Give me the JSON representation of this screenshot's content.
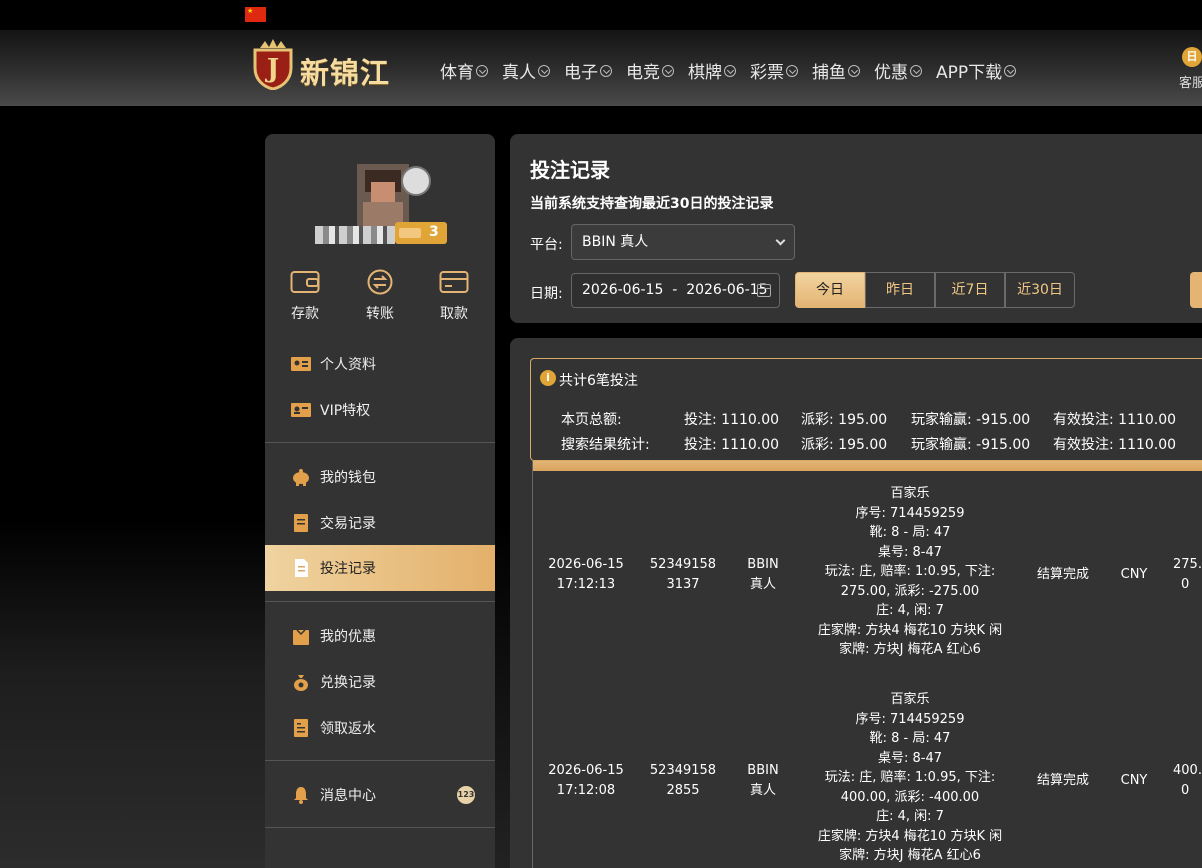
{
  "header": {
    "flag_icon": "china-flag-icon",
    "logo_text": "新锦江",
    "nav": [
      {
        "label": "体育"
      },
      {
        "label": "真人"
      },
      {
        "label": "电子"
      },
      {
        "label": "电竞"
      },
      {
        "label": "棋牌"
      },
      {
        "label": "彩票"
      },
      {
        "label": "捕鱼"
      },
      {
        "label": "优惠"
      },
      {
        "label": "APP下载"
      }
    ],
    "service_label": "客服"
  },
  "sidebar": {
    "vip_level": "3",
    "quick_actions": [
      {
        "label": "存款",
        "icon": "wallet-icon"
      },
      {
        "label": "转账",
        "icon": "transfer-icon"
      },
      {
        "label": "取款",
        "icon": "card-icon"
      }
    ],
    "menu": [
      {
        "label": "个人资料",
        "icon": "id-card-icon"
      },
      {
        "label": "VIP特权",
        "icon": "vip-card-icon"
      },
      {
        "label": "我的钱包",
        "icon": "piggy-bank-icon"
      },
      {
        "label": "交易记录",
        "icon": "ledger-icon"
      },
      {
        "label": "投注记录",
        "icon": "document-icon",
        "active": true
      },
      {
        "label": "我的优惠",
        "icon": "gift-box-icon"
      },
      {
        "label": "兑换记录",
        "icon": "money-bag-icon"
      },
      {
        "label": "领取返水",
        "icon": "receipt-icon"
      },
      {
        "label": "消息中心",
        "icon": "bell-icon",
        "badge": "123"
      }
    ]
  },
  "filter": {
    "title": "投注记录",
    "subtitle": "当前系统支持查询最近30日的投注记录",
    "platform_label": "平台:",
    "platform_value": "BBIN 真人",
    "date_label": "日期:",
    "date_range": "2026-06-15  -  2026-06-15",
    "quick_ranges": [
      "今日",
      "昨日",
      "近7日",
      "近30日"
    ]
  },
  "summary": {
    "title": "共计6笔投注",
    "rows": [
      {
        "label": "本页总额:",
        "bet": "投注: 1110.00",
        "payout": "派彩: 195.00",
        "winloss": "玩家输赢: -915.00",
        "valid": "有效投注: 1110.00"
      },
      {
        "label": "搜索结果统计:",
        "bet": "投注: 1110.00",
        "payout": "派彩: 195.00",
        "winloss": "玩家输赢: -915.00",
        "valid": "有效投注: 1110.00"
      }
    ]
  },
  "records": [
    {
      "date": "2026-06-15",
      "time": "17:12:13",
      "id_a": "52349158",
      "id_b": "3137",
      "platform_a": "BBIN",
      "platform_b": "真人",
      "detail": [
        "百家乐",
        "序号: 714459259",
        "靴: 8 - 局: 47",
        "桌号: 8-47",
        "玩法: 庄, 赔率: 1:0.95, 下注:",
        "275.00, 派彩: -275.00",
        "庄: 4, 闲: 7",
        "庄家牌: 方块4 梅花10 方块K 闲",
        "家牌: 方块J 梅花A 红心6"
      ],
      "status": "结算完成",
      "currency": "CNY",
      "amount_a": "275.",
      "amount_b": "0"
    },
    {
      "date": "2026-06-15",
      "time": "17:12:08",
      "id_a": "52349158",
      "id_b": "2855",
      "platform_a": "BBIN",
      "platform_b": "真人",
      "detail": [
        "百家乐",
        "序号: 714459259",
        "靴: 8 - 局: 47",
        "桌号: 8-47",
        "玩法: 庄, 赔率: 1:0.95, 下注:",
        "400.00, 派彩: -400.00",
        "庄: 4, 闲: 7",
        "庄家牌: 方块4 梅花10 方块K 闲",
        "家牌: 方块J 梅花A 红心6"
      ],
      "status": "结算完成",
      "currency": "CNY",
      "amount_a": "400.",
      "amount_b": "0"
    }
  ]
}
